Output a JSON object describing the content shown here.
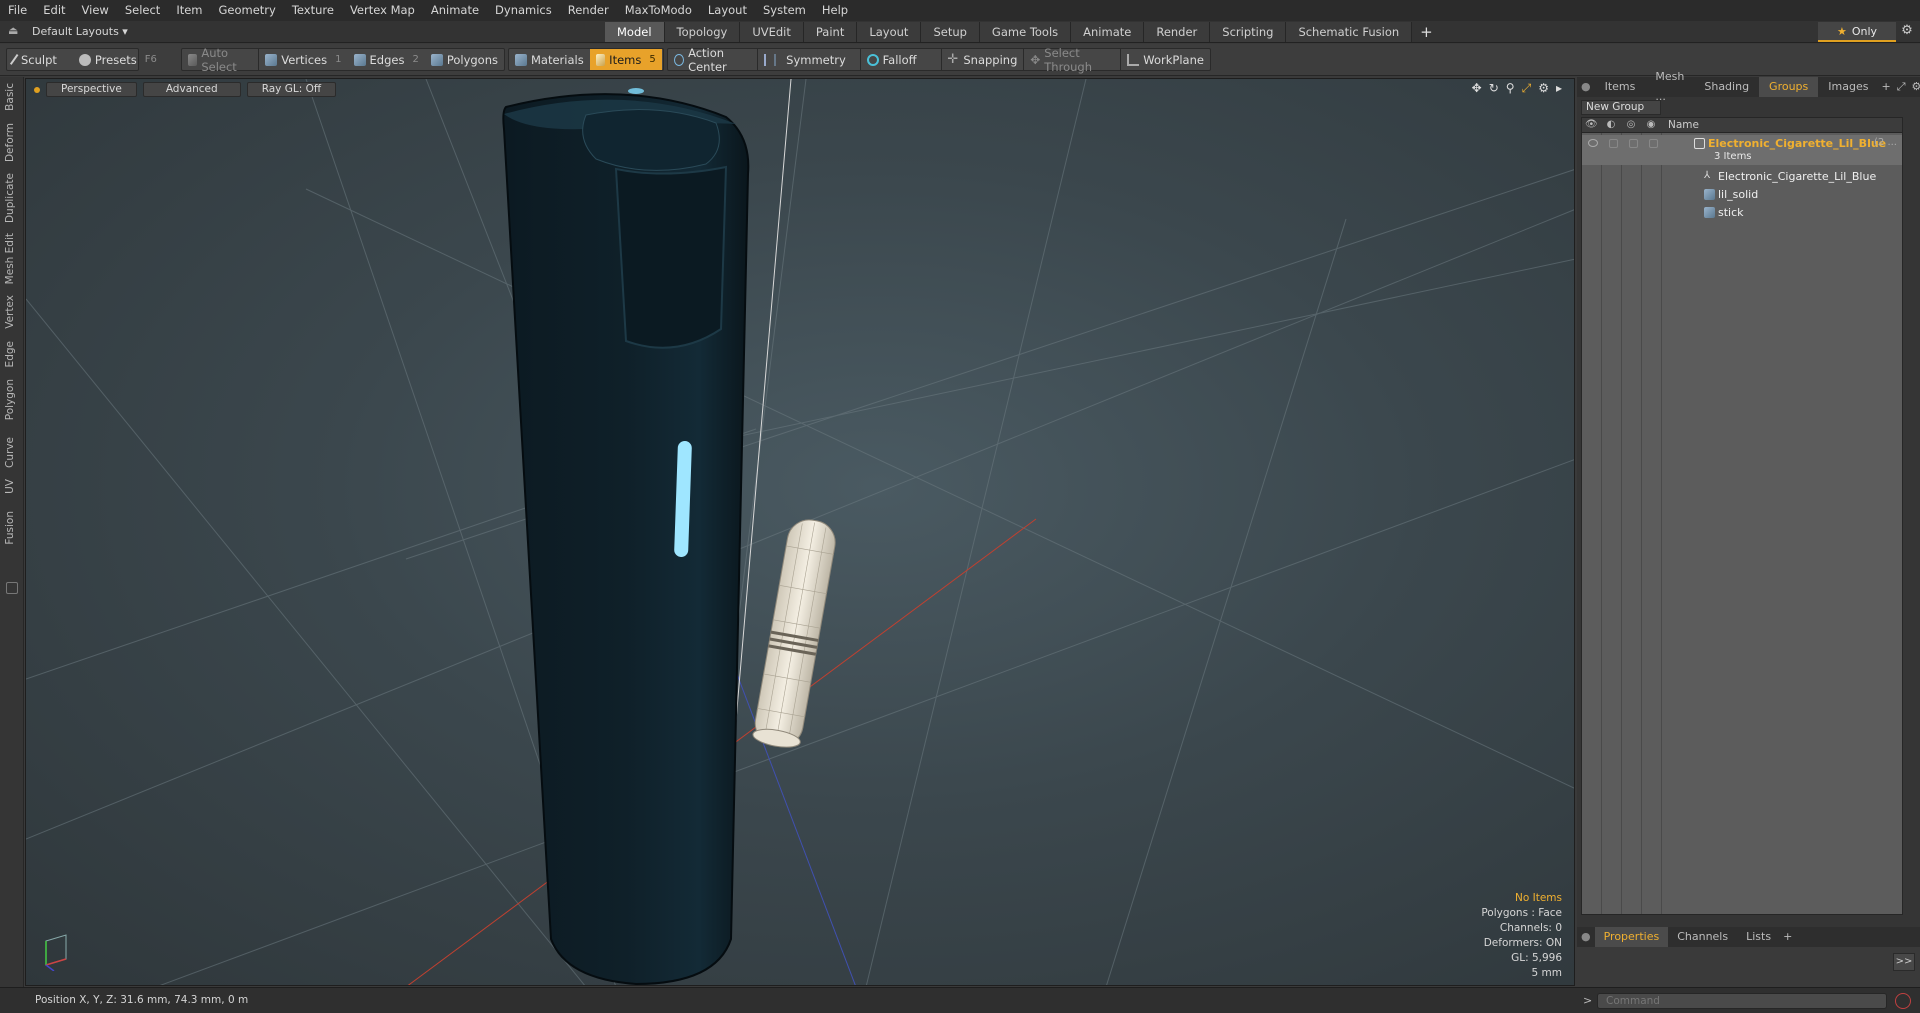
{
  "menu": [
    "File",
    "Edit",
    "View",
    "Select",
    "Item",
    "Geometry",
    "Texture",
    "Vertex Map",
    "Animate",
    "Dynamics",
    "Render",
    "MaxToModo",
    "Layout",
    "System",
    "Help"
  ],
  "layout_selector": "Default Layouts ▾",
  "mode_tabs": [
    "Model",
    "Topology",
    "UVEdit",
    "Paint",
    "Layout",
    "Setup",
    "Game Tools",
    "Animate",
    "Render",
    "Scripting",
    "Schematic Fusion"
  ],
  "active_mode": "Model",
  "only_label": "Only",
  "toolbar": {
    "sculpt": "Sculpt",
    "presets": "Presets",
    "presets_key": "F6",
    "auto_select": "Auto Select",
    "vertices": "Vertices",
    "vertices_key": "1",
    "edges": "Edges",
    "edges_key": "2",
    "polygons": "Polygons",
    "materials": "Materials",
    "items": "Items",
    "items_key": "5",
    "action_center": "Action Center",
    "symmetry": "Symmetry",
    "falloff": "Falloff",
    "snapping": "Snapping",
    "select_through": "Select Through",
    "workplane": "WorkPlane"
  },
  "left_tabs": [
    "Basic",
    "Deform",
    "Duplicate",
    "Mesh Edit",
    "Vertex",
    "Edge",
    "Polygon",
    "Curve",
    "UV",
    "Fusion"
  ],
  "viewport": {
    "view": "Perspective",
    "shading": "Advanced",
    "raygl": "Ray GL: Off",
    "info": {
      "selection": "No Items",
      "polygons": "Polygons : Face",
      "channels": "Channels: 0",
      "deformers": "Deformers: ON",
      "gl": "GL: 5,996",
      "scale": "5 mm"
    }
  },
  "right_panel": {
    "tabs": [
      "Items",
      "Mesh ...",
      "Shading",
      "Groups",
      "Images"
    ],
    "active_tab": "Groups",
    "new_group": "New Group",
    "column_name": "Name",
    "group": {
      "name": "Electronic_Cigarette_Lil_Blue",
      "suffix": "(2 ...",
      "count": "3 Items",
      "children": [
        "Electronic_Cigarette_Lil_Blue",
        "lil_solid",
        "stick"
      ]
    }
  },
  "properties_tabs": [
    "Properties",
    "Channels",
    "Lists"
  ],
  "active_properties_tab": "Properties",
  "status": {
    "position": "Position X, Y, Z:   31.6 mm, 74.3 mm, 0 m"
  },
  "command_placeholder": "Command"
}
